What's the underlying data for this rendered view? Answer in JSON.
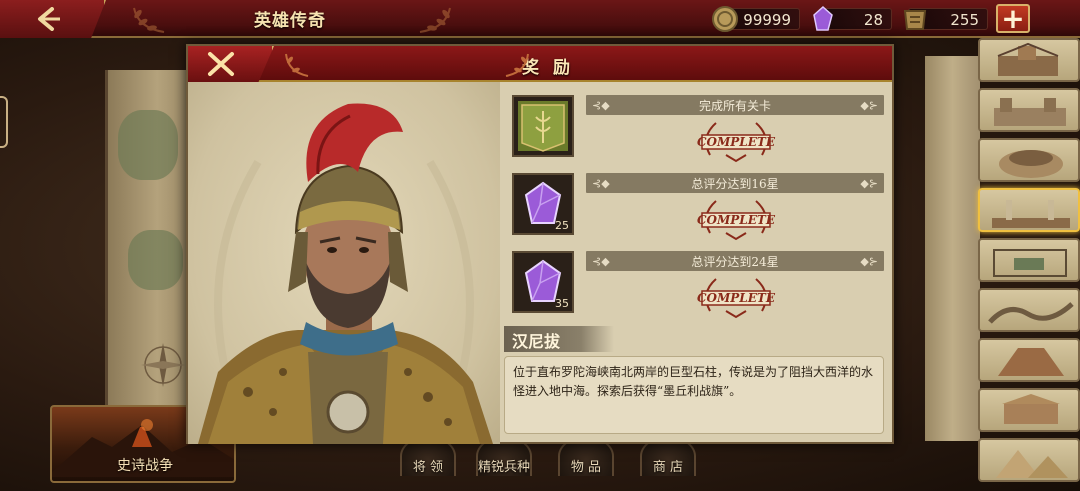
{
  "header": {
    "title": "英雄传奇",
    "back_icon": "back-arrow-icon"
  },
  "resources": [
    {
      "name": "coin",
      "icon": "coin-icon",
      "value": "99999"
    },
    {
      "name": "gem",
      "icon": "purple-gem-icon",
      "value": "28"
    },
    {
      "name": "rank",
      "icon": "laurel-badge-icon",
      "value": "255"
    }
  ],
  "add_button": {
    "label": "+"
  },
  "modal": {
    "title": "奖 励",
    "close_icon": "close-x-icon",
    "rewards": [
      {
        "item_icon": "mercury-banner-icon",
        "count": "",
        "condition": "完成所有关卡",
        "stamp": "COMPLETE"
      },
      {
        "item_icon": "purple-gem-icon",
        "count": "25",
        "condition": "总评分达到16星",
        "stamp": "COMPLETE"
      },
      {
        "item_icon": "purple-gem-icon",
        "count": "35",
        "condition": "总评分达到24星",
        "stamp": "COMPLETE"
      }
    ],
    "hero_name": "汉尼拔",
    "description": "位于直布罗陀海峡南北两岸的巨型石柱，传说是为了阻挡大西洋的水怪进入地中海。探索后获得“墨丘利战旗”。"
  },
  "epic_war": {
    "label": "史诗战争"
  },
  "bottom_nav": [
    {
      "label": "将 领"
    },
    {
      "label": "精锐兵种"
    },
    {
      "label": "物 品"
    },
    {
      "label": "商 店"
    }
  ],
  "buildings": [
    {
      "icon": "fortress-icon",
      "selected": false
    },
    {
      "icon": "castle-wall-icon",
      "selected": false
    },
    {
      "icon": "colosseum-icon",
      "selected": false
    },
    {
      "icon": "pillars-icon",
      "selected": true
    },
    {
      "icon": "garden-icon",
      "selected": false
    },
    {
      "icon": "great-wall-icon",
      "selected": false
    },
    {
      "icon": "ruins-icon",
      "selected": false
    },
    {
      "icon": "parthenon-icon",
      "selected": false
    },
    {
      "icon": "pyramid-icon",
      "selected": false
    }
  ],
  "colors": {
    "header_red": "#6b1616",
    "gold_trim": "#c9a35a",
    "panel_parchment": "#d9ceb0",
    "stamp_red": "#8a2a1a",
    "gem_purple": "#9b5bd8"
  }
}
